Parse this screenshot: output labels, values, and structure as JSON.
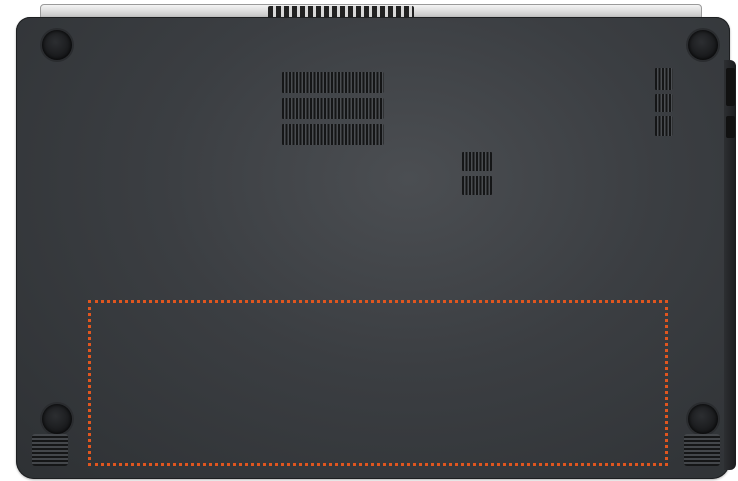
{
  "image": {
    "subject": "laptop-underside",
    "colors": {
      "chassis": "#3b3e42",
      "hinge": "#cfcfcf",
      "highlight_border": "#e0561f",
      "background": "#ffffff"
    },
    "icons": [
      "rubber-foot",
      "vent-grille",
      "speaker-grille",
      "dotted-outline"
    ]
  }
}
